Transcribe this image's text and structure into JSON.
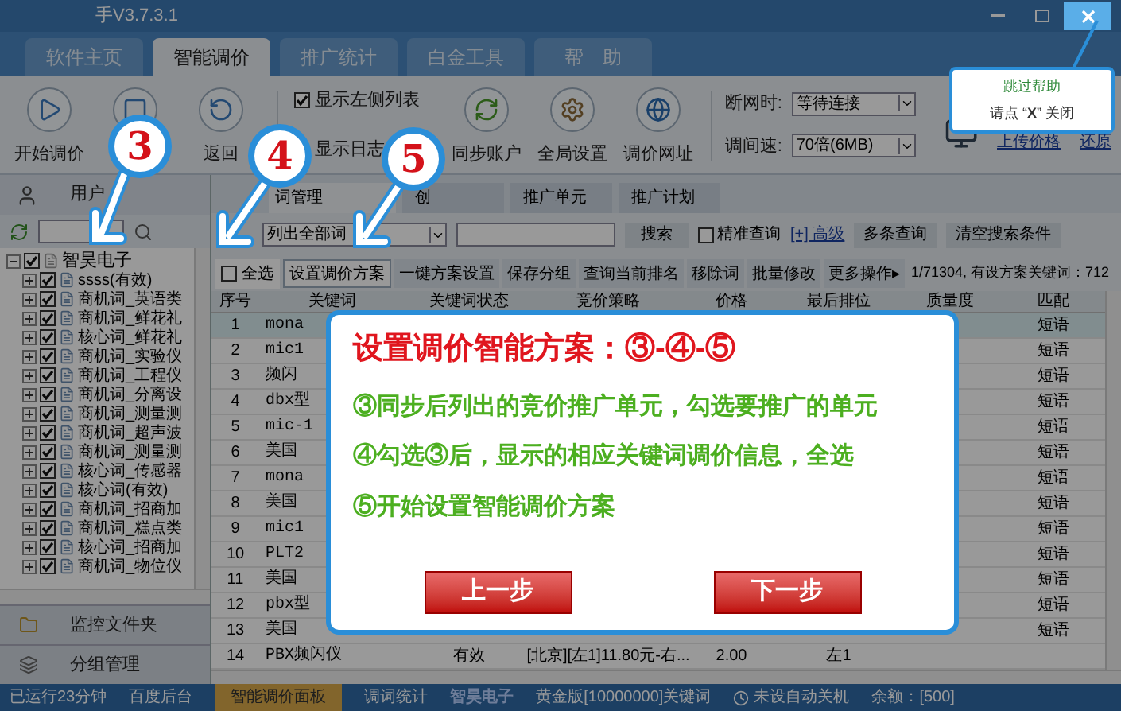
{
  "window": {
    "title": "手V3.7.3.1"
  },
  "tabs": [
    {
      "label": "软件主页",
      "selected": false
    },
    {
      "label": "智能调价",
      "selected": true
    },
    {
      "label": "推广统计",
      "selected": false
    },
    {
      "label": "白金工具",
      "selected": false
    },
    {
      "label": "帮　助",
      "selected": false
    }
  ],
  "toolbar": {
    "buttons": [
      {
        "kind": "play",
        "label": "开始调价"
      },
      {
        "kind": "stop"
      },
      {
        "kind": "undo",
        "label": "返回"
      }
    ],
    "options": [
      {
        "label": "显示左侧列表",
        "checked": true
      },
      {
        "label": "显示日志"
      }
    ],
    "actions": [
      {
        "kind": "sync",
        "label": "同步账户"
      },
      {
        "kind": "settings",
        "label": "全局设置"
      },
      {
        "kind": "globe",
        "label": "调价网址"
      }
    ],
    "fields": [
      {
        "label": "断网时:",
        "value": "等待连接"
      },
      {
        "label": "调间速:",
        "value": "70倍(6MB)"
      }
    ],
    "links": [
      "上传价格",
      "还原"
    ]
  },
  "sidebar": {
    "header": "用户",
    "tree": {
      "label": "智昊电子",
      "expanded": true,
      "checked": true,
      "children": [
        {
          "label": "ssss(有效)",
          "checked": true
        },
        {
          "label": "商机词_英语类",
          "checked": true
        },
        {
          "label": "商机词_鲜花礼",
          "checked": true
        },
        {
          "label": "核心词_鲜花礼",
          "checked": true
        },
        {
          "label": "商机词_实验仪",
          "checked": true
        },
        {
          "label": "商机词_工程仪",
          "checked": true
        },
        {
          "label": "商机词_分离设",
          "checked": true
        },
        {
          "label": "商机词_测量测",
          "checked": true
        },
        {
          "label": "商机词_超声波",
          "checked": true
        },
        {
          "label": "商机词_测量测",
          "checked": true
        },
        {
          "label": "核心词_传感器",
          "checked": true
        },
        {
          "label": "核心词(有效)",
          "checked": true
        },
        {
          "label": "商机词_招商加",
          "checked": true
        },
        {
          "label": "商机词_糕点类",
          "checked": true
        },
        {
          "label": "核心词_招商加",
          "checked": true
        },
        {
          "label": "商机词_物位仪",
          "checked": true
        }
      ]
    },
    "sections": [
      {
        "kind": "folder",
        "label": "监控文件夹"
      },
      {
        "kind": "group",
        "label": "分组管理"
      }
    ]
  },
  "subtabs": [
    {
      "label": "词管理",
      "selected": true
    },
    {
      "label": "创",
      "selected": false
    },
    {
      "label": "推广单元",
      "selected": false
    },
    {
      "label": "推广计划",
      "selected": false
    }
  ],
  "search": {
    "scope": "列出全部词",
    "button": "搜索",
    "exact": {
      "label": "精准查询",
      "checked": false
    },
    "advanced": "[+] 高级",
    "multi": "多条查询",
    "clear": "清空搜索条件"
  },
  "actions_bar": {
    "select_all": {
      "label": "全选",
      "checked": false
    },
    "buttons": [
      {
        "label": "设置调价方案",
        "selected": true
      },
      {
        "label": "一键方案设置",
        "selected": false
      },
      {
        "label": "保存分组",
        "selected": false
      },
      {
        "label": "查询当前排名",
        "selected": false
      },
      {
        "label": "移除词",
        "selected": false
      },
      {
        "label": "批量修改",
        "selected": false
      },
      {
        "label": "更多操作▸",
        "selected": false
      }
    ],
    "summary": "1/71304, 有设方案关键词：712"
  },
  "table": {
    "columns": [
      "序号",
      "关键词",
      "关键词状态",
      "竞价策略",
      "价格",
      "最后排位",
      "质量度",
      "匹配"
    ],
    "rows": [
      {
        "index": "1",
        "keyword": "mona",
        "match": "短语",
        "selected": true
      },
      {
        "index": "2",
        "keyword": "mic1",
        "match": "短语",
        "selected": false
      },
      {
        "index": "3",
        "keyword": "频闪",
        "match": "短语",
        "selected": false
      },
      {
        "index": "4",
        "keyword": "dbx型",
        "match": "短语",
        "selected": false
      },
      {
        "index": "5",
        "keyword": "mic-1",
        "match": "短语",
        "selected": false
      },
      {
        "index": "6",
        "keyword": "美国",
        "match": "短语",
        "selected": false
      },
      {
        "index": "7",
        "keyword": "mona",
        "match": "短语",
        "selected": false
      },
      {
        "index": "8",
        "keyword": "美国",
        "match": "短语",
        "selected": false
      },
      {
        "index": "9",
        "keyword": "mic1",
        "match": "短语",
        "selected": false
      },
      {
        "index": "10",
        "keyword": "PLT2",
        "match": "短语",
        "selected": false
      },
      {
        "index": "11",
        "keyword": "美国",
        "match": "短语",
        "selected": false
      },
      {
        "index": "12",
        "keyword": "pbx型",
        "match": "短语",
        "selected": false
      },
      {
        "index": "13",
        "keyword": "美国",
        "match": "短语",
        "selected": false
      },
      {
        "index": "14",
        "keyword": "PBX频闪仪",
        "status": "有效",
        "strategy": "[北京][左1]11.80元-右...",
        "price": "2.00",
        "last_rank": "左1",
        "selected": false
      }
    ]
  },
  "status_bar": [
    {
      "kind": "plain",
      "text": "已运行23分钟"
    },
    {
      "kind": "plain",
      "text": "百度后台"
    },
    {
      "kind": "active",
      "text": "智能调价面板"
    },
    {
      "kind": "plain",
      "text": "调词统计"
    },
    {
      "kind": "account",
      "text": "智昊电子"
    },
    {
      "kind": "plain",
      "text": "黄金版[10000000]关键词"
    },
    {
      "kind": "clock",
      "text": "未设自动关机"
    },
    {
      "kind": "plain",
      "text": "余额：[500]"
    }
  ],
  "guide": {
    "steps": [
      "3",
      "4",
      "5"
    ],
    "hint": {
      "line1": "跳过帮助",
      "line2": "请点 “**X**” 关闭"
    },
    "dialog": {
      "title": "设置调价智能方案：③-④-⑤",
      "lines": [
        "③同步后列出的竞价推广单元，勾选要推广的单元",
        "④勾选③后，显示的相应关键词调价信息，全选",
        "⑤开始设置智能调价方案"
      ],
      "buttons": [
        "上一步",
        "下一步"
      ]
    }
  }
}
